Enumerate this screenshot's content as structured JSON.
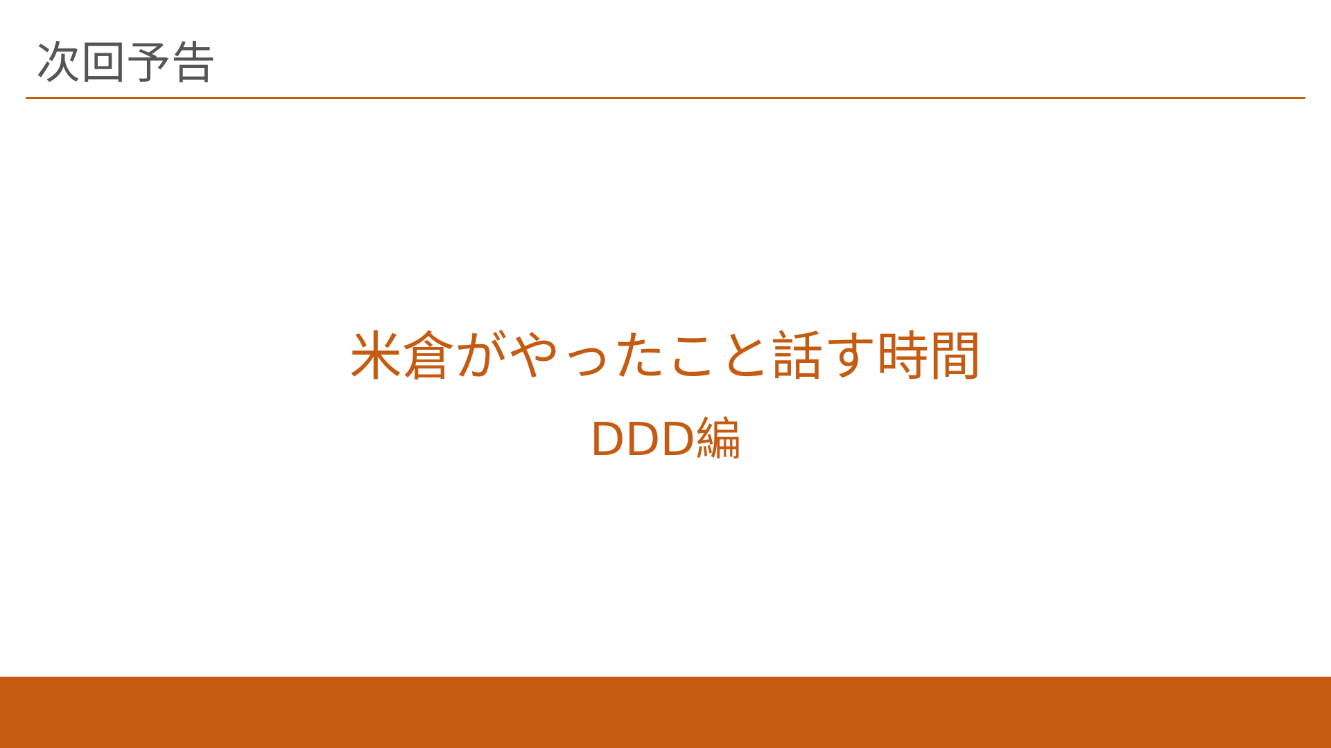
{
  "slide": {
    "title": "次回予告",
    "headline": "米倉がやったこと話す時間",
    "subheadline": "DDD編"
  },
  "colors": {
    "accent": "#c55a11",
    "title_text": "#555555",
    "background": "#ffffff"
  }
}
